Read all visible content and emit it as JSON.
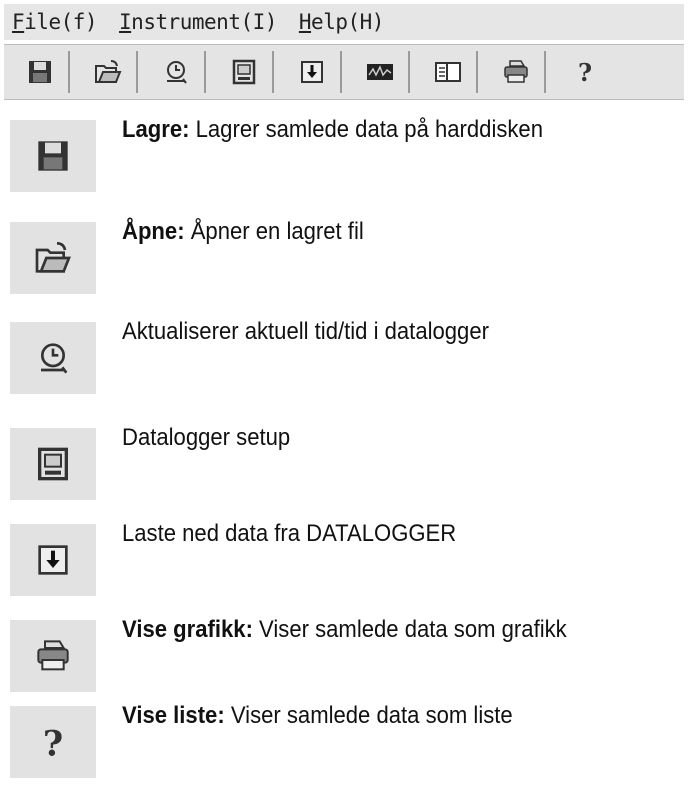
{
  "menu": {
    "file": {
      "mnemonic": "F",
      "rest": "ile(f)"
    },
    "instrument": {
      "mnemonic": "I",
      "rest": "nstrument(I)"
    },
    "help": {
      "mnemonic": "H",
      "rest": "elp(H)"
    }
  },
  "toolbar": {
    "icons": [
      "save-icon",
      "open-icon",
      "clock-icon",
      "setup-icon",
      "download-icon",
      "graph-icon",
      "list-icon",
      "print-icon",
      "help-icon"
    ]
  },
  "legend": [
    {
      "icon": "save-icon",
      "title": "Lagre:",
      "text": " Lagrer samlede data på harddisken"
    },
    {
      "icon": "open-icon",
      "title": "Åpne:",
      "text": " Åpner en lagret fil"
    },
    {
      "icon": "clock-icon",
      "title": "",
      "text": "Aktualiserer aktuell tid/tid i datalogger"
    },
    {
      "icon": "setup-icon",
      "title": "",
      "text": "Datalogger setup"
    },
    {
      "icon": "download-icon",
      "title": "",
      "text": "Laste ned data fra DATALOGGER"
    },
    {
      "icon": "print-icon",
      "title": "Vise grafikk:",
      "text": " Viser samlede data som grafikk"
    },
    {
      "icon": "help-icon",
      "title": "Vise liste:",
      "text": " Viser samlede data som liste"
    }
  ]
}
